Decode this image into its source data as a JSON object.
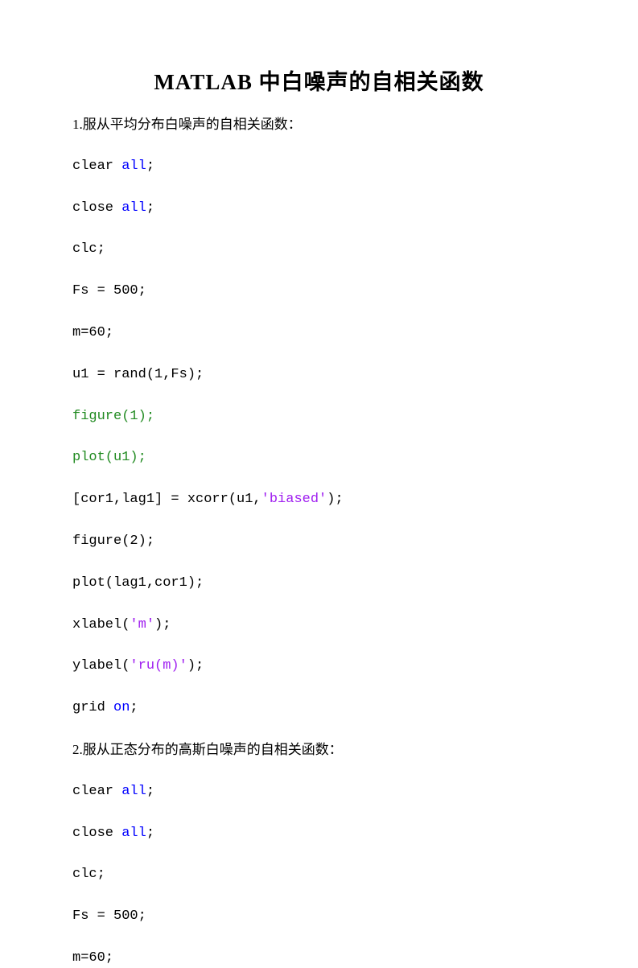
{
  "title": "MATLAB 中白噪声的自相关函数",
  "lines": [
    {
      "type": "heading",
      "tokens": [
        {
          "text": "1.服从平均分布白噪声的自相关函数：",
          "cls": ""
        }
      ]
    },
    {
      "type": "code",
      "tokens": [
        {
          "text": "clear ",
          "cls": ""
        },
        {
          "text": "all",
          "cls": "kw-blue"
        },
        {
          "text": ";",
          "cls": ""
        }
      ]
    },
    {
      "type": "code",
      "tokens": [
        {
          "text": "close ",
          "cls": ""
        },
        {
          "text": "all",
          "cls": "kw-blue"
        },
        {
          "text": ";",
          "cls": ""
        }
      ]
    },
    {
      "type": "code",
      "tokens": [
        {
          "text": "clc;",
          "cls": ""
        }
      ]
    },
    {
      "type": "code",
      "tokens": [
        {
          "text": "Fs = 500;",
          "cls": ""
        }
      ]
    },
    {
      "type": "code",
      "tokens": [
        {
          "text": "m=60;",
          "cls": ""
        }
      ]
    },
    {
      "type": "code",
      "tokens": [
        {
          "text": "u1 = rand(1,Fs);",
          "cls": ""
        }
      ]
    },
    {
      "type": "code",
      "tokens": [
        {
          "text": "figure(1);",
          "cls": "kw-green"
        }
      ]
    },
    {
      "type": "code",
      "tokens": [
        {
          "text": "plot(u1);",
          "cls": "kw-green"
        }
      ]
    },
    {
      "type": "code",
      "tokens": [
        {
          "text": "[cor1,lag1] = xcorr(u1,",
          "cls": ""
        },
        {
          "text": "'biased'",
          "cls": "kw-purple"
        },
        {
          "text": ");",
          "cls": ""
        }
      ]
    },
    {
      "type": "code",
      "tokens": [
        {
          "text": "figure(2);",
          "cls": ""
        }
      ]
    },
    {
      "type": "code",
      "tokens": [
        {
          "text": "plot(lag1,cor1);",
          "cls": ""
        }
      ]
    },
    {
      "type": "code",
      "tokens": [
        {
          "text": "xlabel(",
          "cls": ""
        },
        {
          "text": "'m'",
          "cls": "kw-purple"
        },
        {
          "text": ");",
          "cls": ""
        }
      ]
    },
    {
      "type": "code",
      "tokens": [
        {
          "text": "ylabel(",
          "cls": ""
        },
        {
          "text": "'ru(m)'",
          "cls": "kw-purple"
        },
        {
          "text": ");",
          "cls": ""
        }
      ]
    },
    {
      "type": "code",
      "tokens": [
        {
          "text": "grid ",
          "cls": ""
        },
        {
          "text": "on",
          "cls": "kw-blue"
        },
        {
          "text": ";",
          "cls": ""
        }
      ]
    },
    {
      "type": "heading",
      "tokens": [
        {
          "text": "2.服从正态分布的高斯白噪声的自相关函数：",
          "cls": ""
        }
      ]
    },
    {
      "type": "code",
      "tokens": [
        {
          "text": "clear ",
          "cls": ""
        },
        {
          "text": "all",
          "cls": "kw-blue"
        },
        {
          "text": ";",
          "cls": ""
        }
      ]
    },
    {
      "type": "code",
      "tokens": [
        {
          "text": "close ",
          "cls": ""
        },
        {
          "text": "all",
          "cls": "kw-blue"
        },
        {
          "text": ";",
          "cls": ""
        }
      ]
    },
    {
      "type": "code",
      "tokens": [
        {
          "text": "clc;",
          "cls": ""
        }
      ]
    },
    {
      "type": "code",
      "tokens": [
        {
          "text": "Fs = 500;",
          "cls": ""
        }
      ]
    },
    {
      "type": "code",
      "tokens": [
        {
          "text": "m=60;",
          "cls": ""
        }
      ]
    }
  ]
}
